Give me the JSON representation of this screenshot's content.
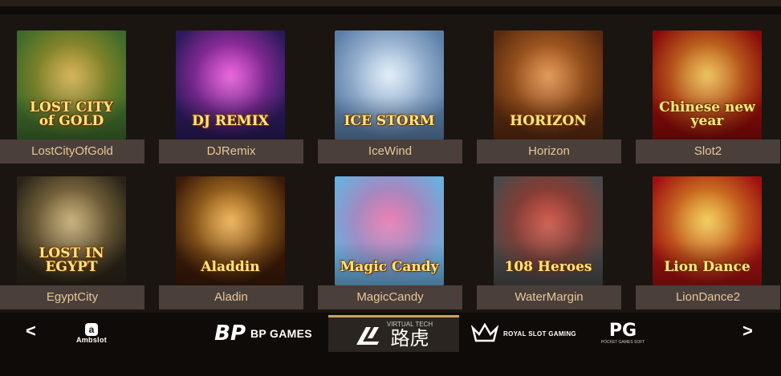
{
  "games": [
    {
      "name": "LostCityOfGold",
      "art_text": "LOST CITY of GOLD",
      "colors": [
        "#3b6a2a",
        "#c89c2a"
      ]
    },
    {
      "name": "DJRemix",
      "art_text": "DJ REMIX",
      "colors": [
        "#2a1a5a",
        "#e03ad0"
      ]
    },
    {
      "name": "IceWind",
      "art_text": "ICE STORM",
      "colors": [
        "#5a7ea8",
        "#d8e8f8"
      ]
    },
    {
      "name": "Horizon",
      "art_text": "HORIZON",
      "colors": [
        "#5a2a10",
        "#d87a2a"
      ]
    },
    {
      "name": "Slot2",
      "art_text": "Chinese new year",
      "colors": [
        "#8a0a0a",
        "#e8b030"
      ]
    },
    {
      "name": "EgyptCity",
      "art_text": "LOST IN EGYPT",
      "colors": [
        "#2a2418",
        "#b89a5a"
      ]
    },
    {
      "name": "Aladin",
      "art_text": "Aladdin",
      "colors": [
        "#3a1a08",
        "#e8a030"
      ]
    },
    {
      "name": "MagicCandy",
      "art_text": "Magic Candy",
      "colors": [
        "#6ab0e0",
        "#e060a0"
      ]
    },
    {
      "name": "WaterMargin",
      "art_text": "108 Heroes",
      "colors": [
        "#4a4a4a",
        "#c03020"
      ]
    },
    {
      "name": "LionDance2",
      "art_text": "Lion Dance",
      "colors": [
        "#a01010",
        "#f0c030"
      ]
    }
  ],
  "providers": {
    "prev_label": "<",
    "next_label": ">",
    "ambslot": {
      "name": "Ambslot",
      "glyph": "a"
    },
    "bpgames": {
      "name": "BP GAMES",
      "glyph": "BP"
    },
    "vt": {
      "name": "路虎",
      "sub": "VIRTUAL TECH"
    },
    "royal": {
      "name": "ROYAL SLOT GAMING"
    },
    "pg": {
      "name": "PG",
      "sub": "POCKET GAMES SOFT"
    }
  },
  "colors": {
    "label_bg": "#4a3f3a",
    "label_text": "#e6c79a",
    "active_border": "#c8a26a"
  }
}
